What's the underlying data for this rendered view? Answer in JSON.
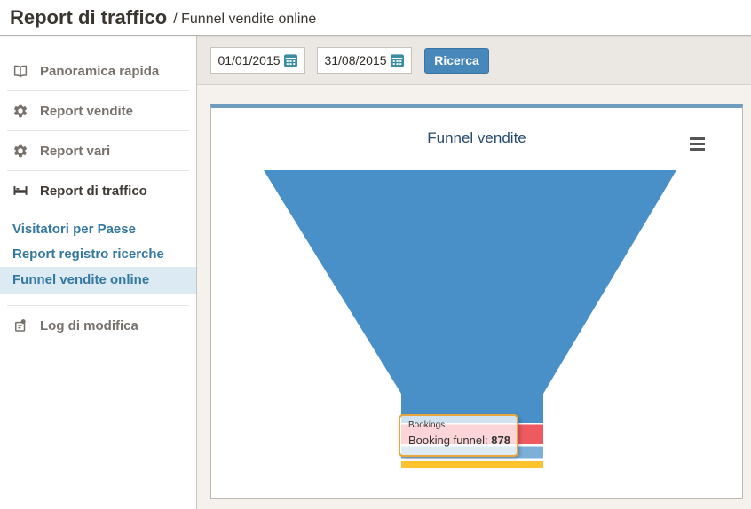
{
  "header": {
    "title": "Report di traffico",
    "breadcrumb": "/ Funnel vendite online"
  },
  "sidebar": {
    "items": [
      {
        "label": "Panoramica rapida",
        "icon": "book-icon"
      },
      {
        "label": "Report vendite",
        "icon": "gear-icon"
      },
      {
        "label": "Report vari",
        "icon": "gear-icon"
      },
      {
        "label": "Report di traffico",
        "icon": "bed-icon",
        "active": true
      }
    ],
    "subitems": [
      {
        "label": "Visitatori per Paese"
      },
      {
        "label": "Report registro ricerche"
      },
      {
        "label": "Funnel vendite online",
        "selected": true
      }
    ],
    "log_item": {
      "label": "Log di modifica",
      "icon": "log-icon"
    }
  },
  "toolbar": {
    "date_from": "01/01/2015",
    "date_to": "31/08/2015",
    "search_button": "Ricerca"
  },
  "chart": {
    "title": "Funnel vendite"
  },
  "tooltip": {
    "series": "Bookings",
    "label": "Booking funnel",
    "separator": ": ",
    "value": "878"
  },
  "chart_data": {
    "type": "funnel",
    "title": "Funnel vendite",
    "series_name": "Bookings",
    "legend": false,
    "tooltip_visible": {
      "series": "Bookings",
      "point_name": "Booking funnel",
      "value": 878
    },
    "segments": [
      {
        "order": 1,
        "color": "#4a90c8",
        "note": "large top funnel segment, value not shown"
      },
      {
        "order": 2,
        "color": "#ee5a60",
        "note": "value not shown"
      },
      {
        "order": 3,
        "color": "#7db0d8",
        "note": "value not shown"
      },
      {
        "order": 4,
        "name": "Booking funnel",
        "color": "#fcc32c",
        "value": 878
      }
    ]
  },
  "colors": {
    "button_blue": "#4787b9",
    "panel_top_bar": "#6f9dbf",
    "funnel_blue": "#4a90c8",
    "funnel_red": "#ee5a60",
    "funnel_light_blue": "#7db0d8",
    "funnel_yellow": "#fcc32c",
    "tooltip_border": "#e9a63b",
    "sidebar_link": "#35789f",
    "sidebar_selected_bg": "#dcebf3",
    "chart_title": "#274b6d",
    "calendar_icon": "#3b8da3"
  }
}
